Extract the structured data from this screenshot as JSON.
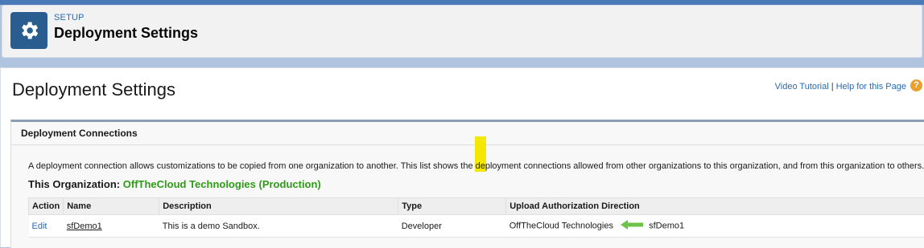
{
  "header": {
    "setup_label": "SETUP",
    "title": "Deployment Settings",
    "icon": "gear-icon"
  },
  "page": {
    "title": "Deployment Settings",
    "help": {
      "video_tutorial": "Video Tutorial",
      "separator": "|",
      "help_page": "Help for this Page",
      "help_icon": "?"
    }
  },
  "panel": {
    "title": "Deployment Connections",
    "description": "A deployment connection allows customizations to be copied from one organization to another. This list shows the deployment connections allowed from other organizations to this organization, and from this organization to others.",
    "org_label": "This Organization:",
    "org_name": "OffTheCloud Technologies (Production)"
  },
  "table": {
    "headers": {
      "action": "Action",
      "name": "Name",
      "description": "Description",
      "type": "Type",
      "direction": "Upload Authorization Direction"
    },
    "rows": [
      {
        "action": "Edit",
        "name": "sfDemo1",
        "description": "This is a demo Sandbox.",
        "type": "Developer",
        "from": "OffTheCloud Technologies",
        "to": "sfDemo1"
      }
    ]
  },
  "colors": {
    "accent": "#2a6bb3",
    "org_green": "#2e9b16",
    "arrow_green": "#6cc24a",
    "highlight": "#f5e800"
  }
}
